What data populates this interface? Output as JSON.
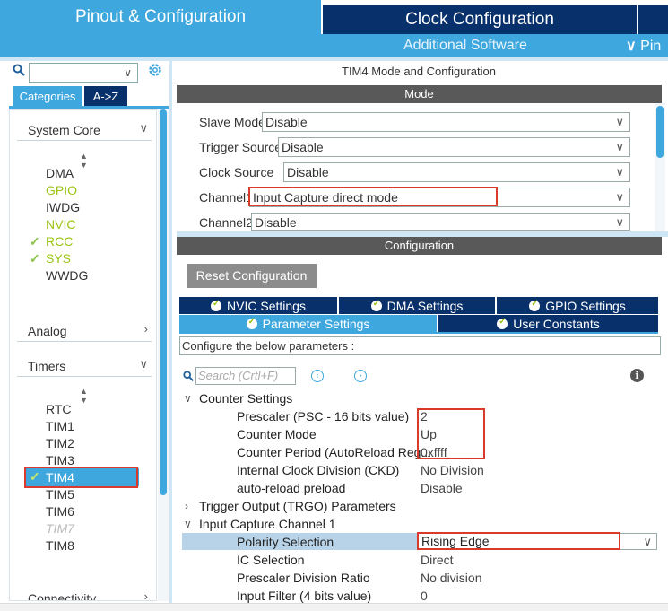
{
  "tabs": {
    "pinout": "Pinout & Configuration",
    "clock": "Clock Configuration",
    "additional": "Additional Software",
    "pinout_short": "Pin"
  },
  "left": {
    "categories_tab": "Categories",
    "az_tab": "A->Z",
    "groups": {
      "system_core": "System Core",
      "analog": "Analog",
      "timers": "Timers",
      "connectivity": "Connectivity"
    },
    "system_core_items": [
      "DMA",
      "GPIO",
      "IWDG",
      "NVIC",
      "RCC",
      "SYS",
      "WWDG"
    ],
    "timer_items": [
      "RTC",
      "TIM1",
      "TIM2",
      "TIM3",
      "TIM4",
      "TIM5",
      "TIM6",
      "TIM7",
      "TIM8"
    ]
  },
  "mode": {
    "title": "TIM4 Mode and Configuration",
    "header": "Mode",
    "fields": [
      {
        "label": "Slave Mode",
        "value": "Disable"
      },
      {
        "label": "Trigger Source",
        "value": "Disable"
      },
      {
        "label": "Clock Source",
        "value": "Disable"
      },
      {
        "label": "Channel1",
        "value": "Input Capture direct mode"
      },
      {
        "label": "Channel2",
        "value": "Disable"
      }
    ]
  },
  "config": {
    "header": "Configuration",
    "reset_label": "Reset Configuration",
    "tabs": {
      "nvic": "NVIC Settings",
      "dma": "DMA Settings",
      "gpio": "GPIO Settings",
      "parameter": "Parameter Settings",
      "user_constants": "User Constants"
    },
    "hint": "Configure the below parameters :",
    "search_placeholder": "Search (Crtl+F)",
    "sections": {
      "counter": "Counter Settings",
      "trgo": "Trigger Output (TRGO) Parameters",
      "ic1": "Input Capture Channel 1"
    },
    "counter_params": [
      {
        "label": "Prescaler (PSC - 16 bits value)",
        "value": "2"
      },
      {
        "label": "Counter Mode",
        "value": "Up"
      },
      {
        "label": "Counter Period (AutoReload Reg...",
        "value": "0xffff"
      },
      {
        "label": "Internal Clock Division (CKD)",
        "value": "No Division"
      },
      {
        "label": "auto-reload preload",
        "value": "Disable"
      }
    ],
    "ic1_params": [
      {
        "label": "Polarity Selection",
        "value": "Rising Edge"
      },
      {
        "label": "IC Selection",
        "value": "Direct"
      },
      {
        "label": "Prescaler Division Ratio",
        "value": "No division"
      },
      {
        "label": "Input Filter (4 bits value)",
        "value": "0"
      }
    ]
  }
}
